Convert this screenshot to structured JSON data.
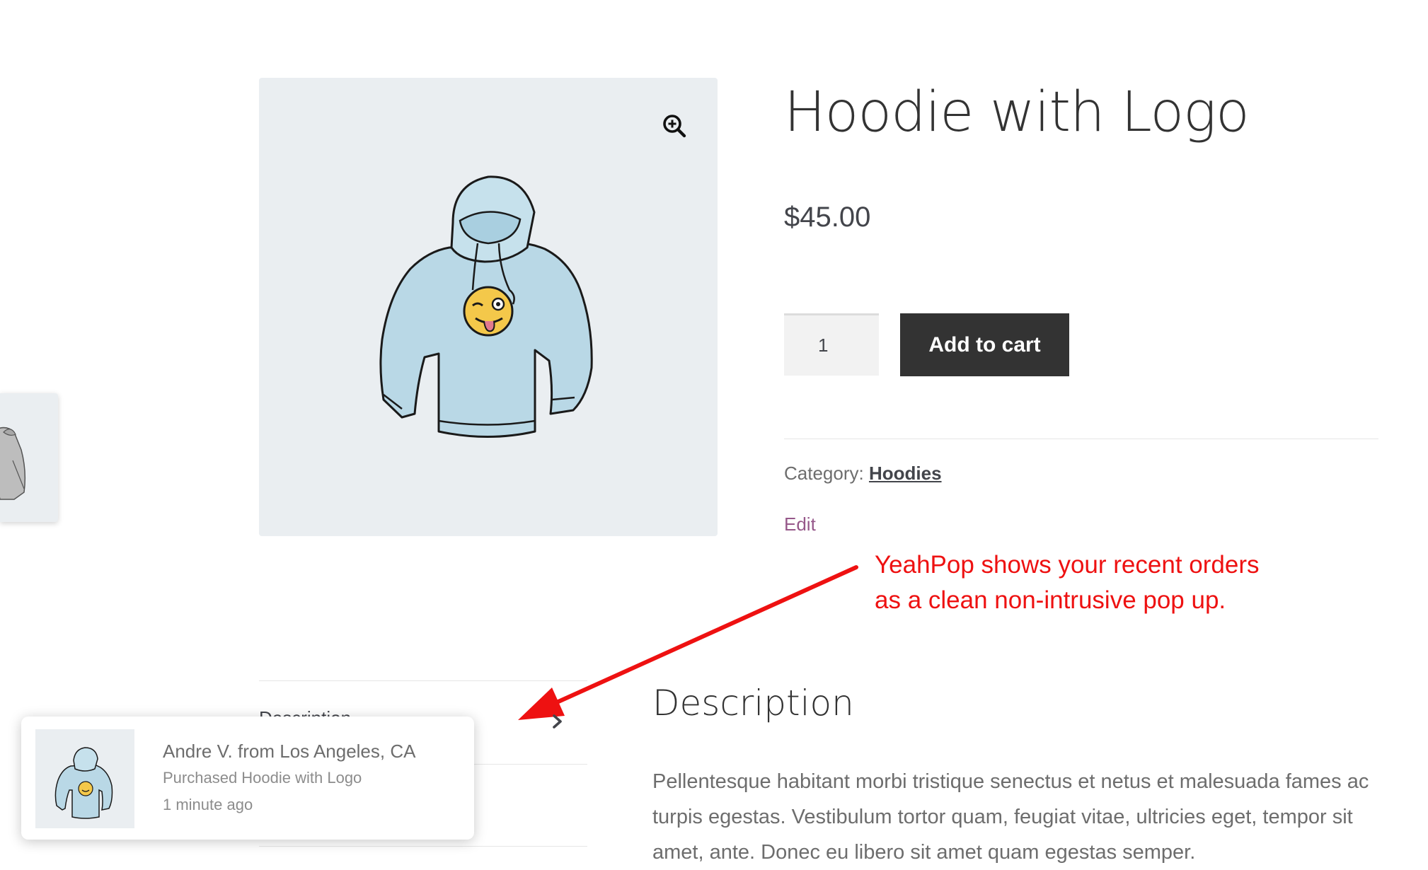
{
  "product": {
    "title": "Hoodie with Logo",
    "price": "$45.00",
    "quantity": "1",
    "add_to_cart_label": "Add to cart",
    "category_label": "Category:",
    "category_value": "Hoodies",
    "edit_label": "Edit"
  },
  "annotation": {
    "line1": "YeahPop shows your recent orders",
    "line2": "as a clean non-intrusive pop up.",
    "color": "#ee1111"
  },
  "tabs": {
    "items": [
      {
        "label": "Description"
      }
    ]
  },
  "description": {
    "heading": "Description",
    "text": "Pellentesque habitant morbi tristique senectus et netus et malesuada fames ac turpis egestas. Vestibulum tortor quam, feugiat vitae, ultricies eget, tempor sit amet, ante. Donec eu libero sit amet quam egestas semper."
  },
  "popup": {
    "name": "Andre V. from Los Angeles, CA",
    "action": "Purchased Hoodie with Logo",
    "time": "1 minute ago"
  },
  "colors": {
    "button_bg": "#333333",
    "link": "#96588a",
    "image_bg": "#eaeef1"
  },
  "icons": {
    "zoom": "zoom-in-icon",
    "chevron": "chevron-right-icon"
  }
}
